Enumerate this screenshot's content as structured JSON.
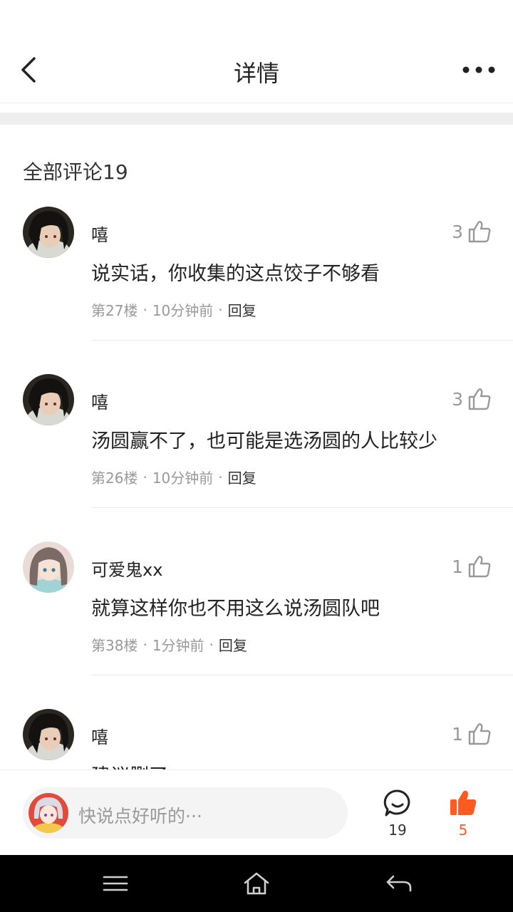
{
  "header": {
    "title": "详情",
    "back_icon": "chevron-left-icon",
    "more_icon": "more-horizontal-icon"
  },
  "comments_section": {
    "title": "全部评论19"
  },
  "comments": [
    {
      "username": "嘻",
      "likes": "3",
      "text": "说实话，你收集的这点饺子不够看",
      "floor": "第27楼",
      "time": "10分钟前",
      "reply": "回复",
      "avatar": "dark-hair-avatar"
    },
    {
      "username": "嘻",
      "likes": "3",
      "text": "汤圆赢不了，也可能是选汤圆的人比较少",
      "floor": "第26楼",
      "time": "10分钟前",
      "reply": "回复",
      "avatar": "dark-hair-avatar"
    },
    {
      "username": "可爱鬼xx",
      "likes": "1",
      "text": "就算这样你也不用这么说汤圆队吧",
      "floor": "第38楼",
      "time": "1分钟前",
      "reply": "回复",
      "avatar": "anime-girl-avatar"
    },
    {
      "username": "嘻",
      "likes": "1",
      "text": "建议删了",
      "floor": "",
      "time": "",
      "reply": "",
      "avatar": "dark-hair-avatar"
    }
  ],
  "bottom_bar": {
    "input_placeholder": "快说点好听的···",
    "comment_count": "19",
    "like_count": "5",
    "accent_color": "#ff5a1f"
  },
  "system_nav": {
    "menu_icon": "menu-icon",
    "home_icon": "home-icon",
    "back_icon": "back-arrow-icon"
  }
}
